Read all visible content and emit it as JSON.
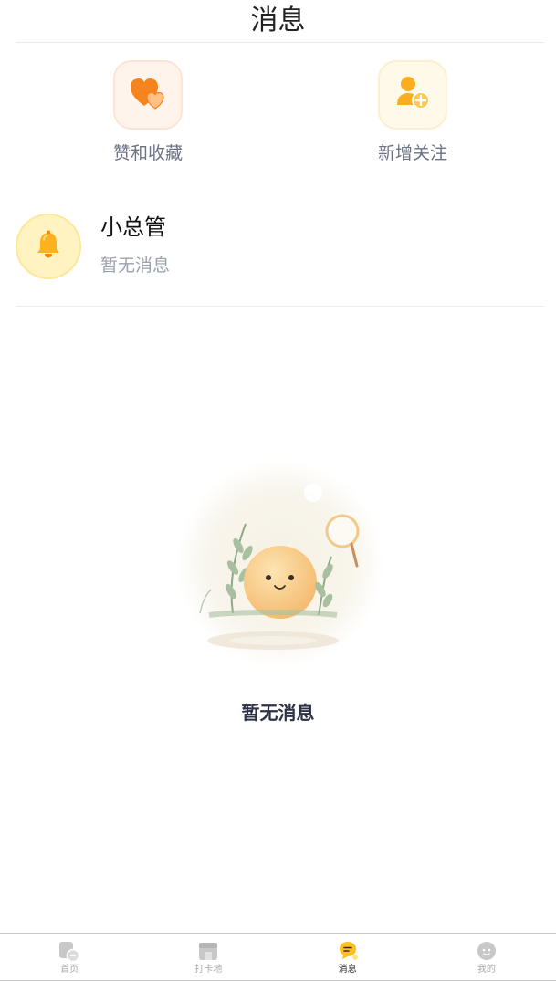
{
  "header": {
    "title": "消息"
  },
  "quick_actions": [
    {
      "label": "赞和收藏",
      "icon": "heart-icon",
      "color": "#f7831e"
    },
    {
      "label": "新增关注",
      "icon": "add-user-icon",
      "color": "#f9ad1f"
    }
  ],
  "admin": {
    "name": "小总管",
    "preview": "暂无消息",
    "icon": "bell-icon",
    "accent": "#fbb21e"
  },
  "empty_state": {
    "text": "暂无消息",
    "illustration": "smiling-ball-illustration"
  },
  "tabbar": {
    "active_index": 2,
    "active_color": "#fbbf24",
    "inactive_color": "#c8c8c8",
    "items": [
      {
        "label": "首页",
        "icon": "home-icon"
      },
      {
        "label": "打卡地",
        "icon": "store-icon"
      },
      {
        "label": "消息",
        "icon": "message-icon"
      },
      {
        "label": "我的",
        "icon": "profile-icon"
      }
    ]
  }
}
